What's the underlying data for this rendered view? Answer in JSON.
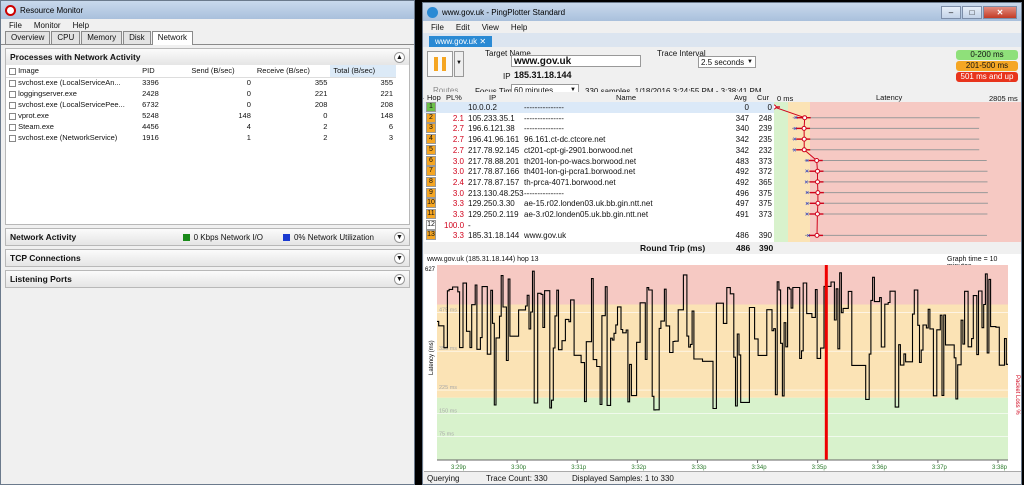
{
  "rm": {
    "title": "Resource Monitor",
    "menu": [
      "File",
      "Monitor",
      "Help"
    ],
    "tabs": [
      "Overview",
      "CPU",
      "Memory",
      "Disk",
      "Network"
    ],
    "sec1": "Processes with Network Activity",
    "cols": [
      "Image",
      "PID",
      "Send (B/sec)",
      "Receive (B/sec)",
      "Total (B/sec)"
    ],
    "rows": [
      [
        "svchost.exe (LocalServiceAn...",
        "3396",
        "0",
        "355",
        "355"
      ],
      [
        "loggingserver.exe",
        "2428",
        "0",
        "221",
        "221"
      ],
      [
        "svchost.exe (LocalServicePee...",
        "6732",
        "0",
        "208",
        "208"
      ],
      [
        "vprot.exe",
        "5248",
        "148",
        "0",
        "148"
      ],
      [
        "Steam.exe",
        "4456",
        "4",
        "2",
        "6"
      ],
      [
        "svchost.exe (NetworkService)",
        "1916",
        "1",
        "2",
        "3"
      ]
    ],
    "sec2": "Network Activity",
    "io": "0 Kbps Network I/O",
    "util": "0% Network Utilization",
    "sec3": "TCP Connections",
    "sec4": "Listening Ports"
  },
  "pp": {
    "title": "www.gov.uk - PingPlotter Standard",
    "menu": [
      "File",
      "Edit",
      "View",
      "Help"
    ],
    "tab": "www.gov.uk",
    "target_label": "Target Name",
    "target": "www.gov.uk",
    "ip_label": "IP",
    "ip": "185.31.18.144",
    "interval_label": "Trace Interval",
    "interval": "2.5 seconds",
    "focus_label": "Focus Time",
    "focus": "60 minutes",
    "samples": "330 samples, 1/18/2016 3:24:55 PM - 3:38:41 PM",
    "routes": "Routes",
    "legend": [
      "0-200 ms",
      "201-500 ms",
      "501 ms and up"
    ],
    "legend_colors": [
      "#8fe07a",
      "#f5a623",
      "#e8341c"
    ],
    "hcols": [
      "Hop",
      "PL%",
      "IP",
      "Name",
      "Avg",
      "Cur"
    ],
    "lat_head": "Latency",
    "ms0": "0 ms",
    "msmax": "2805 ms",
    "hops": [
      {
        "n": "1",
        "pl": "",
        "ip": "10.0.0.2",
        "name": "---------------",
        "avg": "0",
        "cur": "0",
        "c": "#6cc04a"
      },
      {
        "n": "2",
        "pl": "2.1",
        "ip": "105.233.35.1",
        "name": "---------------",
        "avg": "347",
        "cur": "248",
        "c": "#f5a623"
      },
      {
        "n": "3",
        "pl": "2.7",
        "ip": "196.6.121.38",
        "name": "---------------",
        "avg": "340",
        "cur": "239",
        "c": "#f5a623"
      },
      {
        "n": "4",
        "pl": "2.7",
        "ip": "196.41.96.161",
        "name": "96.161.ct-dc.ctcore.net",
        "avg": "342",
        "cur": "235",
        "c": "#f5a623"
      },
      {
        "n": "5",
        "pl": "2.7",
        "ip": "217.78.92.145",
        "name": "ct201-cpt-gi-2901.borwood.net",
        "avg": "342",
        "cur": "232",
        "c": "#f5a623"
      },
      {
        "n": "6",
        "pl": "3.0",
        "ip": "217.78.88.201",
        "name": "th201-lon-po-wacs.borwood.net",
        "avg": "483",
        "cur": "373",
        "c": "#f5a623"
      },
      {
        "n": "7",
        "pl": "3.0",
        "ip": "217.78.87.166",
        "name": "th401-lon-gi-pcra1.borwood.net",
        "avg": "492",
        "cur": "372",
        "c": "#f5a623"
      },
      {
        "n": "8",
        "pl": "2.4",
        "ip": "217.78.87.157",
        "name": "th-prca-4071.borwood.net",
        "avg": "492",
        "cur": "365",
        "c": "#f5a623"
      },
      {
        "n": "9",
        "pl": "3.0",
        "ip": "213.130.48.253",
        "name": "---------------",
        "avg": "496",
        "cur": "375",
        "c": "#f5a623"
      },
      {
        "n": "10",
        "pl": "3.3",
        "ip": "129.250.3.30",
        "name": "ae-15.r02.londen03.uk.bb.gin.ntt.net",
        "avg": "497",
        "cur": "375",
        "c": "#f5a623"
      },
      {
        "n": "11",
        "pl": "3.3",
        "ip": "129.250.2.119",
        "name": "ae-3.r02.londen05.uk.bb.gin.ntt.net",
        "avg": "491",
        "cur": "373",
        "c": "#f5a623"
      },
      {
        "n": "12",
        "pl": "100.0",
        "ip": "-",
        "name": "",
        "avg": "",
        "cur": "",
        "c": "#ffffff"
      },
      {
        "n": "13",
        "pl": "3.3",
        "ip": "185.31.18.144",
        "name": "www.gov.uk",
        "avg": "486",
        "cur": "390",
        "c": "#f5a623"
      }
    ],
    "rt_label": "Round Trip (ms)",
    "rt_avg": "486",
    "rt_cur": "390",
    "graph_title": "www.gov.uk (185.31.18.144) hop 13",
    "graph_time": "Graph time = 10 minutes",
    "ytick_top": "627",
    "ylabel": "Latency (ms)",
    "ylabel_r": "Packet Loss %",
    "ylabels": [
      "475 ms",
      "350 ms",
      "225 ms",
      "150 ms",
      "75 ms"
    ],
    "xlabels": [
      "3:29p",
      "3:30p",
      "3:31p",
      "3:32p",
      "3:33p",
      "3:34p",
      "3:35p",
      "3:36p",
      "3:37p",
      "3:38p"
    ],
    "status": "Querying",
    "trace": "Trace Count: 330",
    "disp": "Displayed Samples: 1 to 330"
  }
}
